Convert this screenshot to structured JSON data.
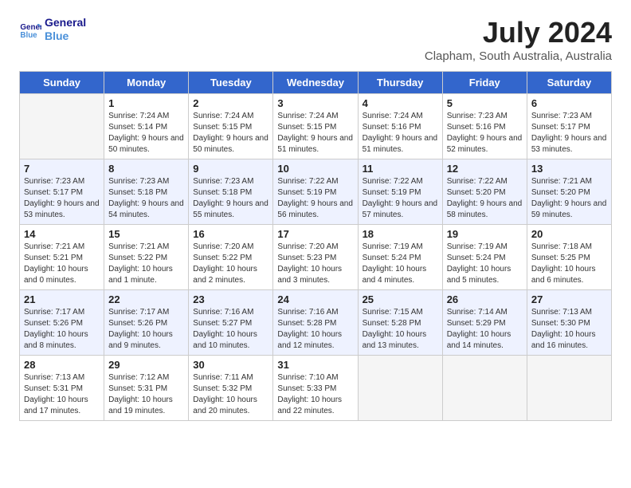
{
  "header": {
    "logo_line1": "General",
    "logo_line2": "Blue",
    "title": "July 2024",
    "subtitle": "Clapham, South Australia, Australia"
  },
  "weekdays": [
    "Sunday",
    "Monday",
    "Tuesday",
    "Wednesday",
    "Thursday",
    "Friday",
    "Saturday"
  ],
  "weeks": [
    [
      {
        "day": "",
        "sunrise": "",
        "sunset": "",
        "daylight": ""
      },
      {
        "day": "1",
        "sunrise": "Sunrise: 7:24 AM",
        "sunset": "Sunset: 5:14 PM",
        "daylight": "Daylight: 9 hours and 50 minutes."
      },
      {
        "day": "2",
        "sunrise": "Sunrise: 7:24 AM",
        "sunset": "Sunset: 5:15 PM",
        "daylight": "Daylight: 9 hours and 50 minutes."
      },
      {
        "day": "3",
        "sunrise": "Sunrise: 7:24 AM",
        "sunset": "Sunset: 5:15 PM",
        "daylight": "Daylight: 9 hours and 51 minutes."
      },
      {
        "day": "4",
        "sunrise": "Sunrise: 7:24 AM",
        "sunset": "Sunset: 5:16 PM",
        "daylight": "Daylight: 9 hours and 51 minutes."
      },
      {
        "day": "5",
        "sunrise": "Sunrise: 7:23 AM",
        "sunset": "Sunset: 5:16 PM",
        "daylight": "Daylight: 9 hours and 52 minutes."
      },
      {
        "day": "6",
        "sunrise": "Sunrise: 7:23 AM",
        "sunset": "Sunset: 5:17 PM",
        "daylight": "Daylight: 9 hours and 53 minutes."
      }
    ],
    [
      {
        "day": "7",
        "sunrise": "Sunrise: 7:23 AM",
        "sunset": "Sunset: 5:17 PM",
        "daylight": "Daylight: 9 hours and 53 minutes."
      },
      {
        "day": "8",
        "sunrise": "Sunrise: 7:23 AM",
        "sunset": "Sunset: 5:18 PM",
        "daylight": "Daylight: 9 hours and 54 minutes."
      },
      {
        "day": "9",
        "sunrise": "Sunrise: 7:23 AM",
        "sunset": "Sunset: 5:18 PM",
        "daylight": "Daylight: 9 hours and 55 minutes."
      },
      {
        "day": "10",
        "sunrise": "Sunrise: 7:22 AM",
        "sunset": "Sunset: 5:19 PM",
        "daylight": "Daylight: 9 hours and 56 minutes."
      },
      {
        "day": "11",
        "sunrise": "Sunrise: 7:22 AM",
        "sunset": "Sunset: 5:19 PM",
        "daylight": "Daylight: 9 hours and 57 minutes."
      },
      {
        "day": "12",
        "sunrise": "Sunrise: 7:22 AM",
        "sunset": "Sunset: 5:20 PM",
        "daylight": "Daylight: 9 hours and 58 minutes."
      },
      {
        "day": "13",
        "sunrise": "Sunrise: 7:21 AM",
        "sunset": "Sunset: 5:20 PM",
        "daylight": "Daylight: 9 hours and 59 minutes."
      }
    ],
    [
      {
        "day": "14",
        "sunrise": "Sunrise: 7:21 AM",
        "sunset": "Sunset: 5:21 PM",
        "daylight": "Daylight: 10 hours and 0 minutes."
      },
      {
        "day": "15",
        "sunrise": "Sunrise: 7:21 AM",
        "sunset": "Sunset: 5:22 PM",
        "daylight": "Daylight: 10 hours and 1 minute."
      },
      {
        "day": "16",
        "sunrise": "Sunrise: 7:20 AM",
        "sunset": "Sunset: 5:22 PM",
        "daylight": "Daylight: 10 hours and 2 minutes."
      },
      {
        "day": "17",
        "sunrise": "Sunrise: 7:20 AM",
        "sunset": "Sunset: 5:23 PM",
        "daylight": "Daylight: 10 hours and 3 minutes."
      },
      {
        "day": "18",
        "sunrise": "Sunrise: 7:19 AM",
        "sunset": "Sunset: 5:24 PM",
        "daylight": "Daylight: 10 hours and 4 minutes."
      },
      {
        "day": "19",
        "sunrise": "Sunrise: 7:19 AM",
        "sunset": "Sunset: 5:24 PM",
        "daylight": "Daylight: 10 hours and 5 minutes."
      },
      {
        "day": "20",
        "sunrise": "Sunrise: 7:18 AM",
        "sunset": "Sunset: 5:25 PM",
        "daylight": "Daylight: 10 hours and 6 minutes."
      }
    ],
    [
      {
        "day": "21",
        "sunrise": "Sunrise: 7:17 AM",
        "sunset": "Sunset: 5:26 PM",
        "daylight": "Daylight: 10 hours and 8 minutes."
      },
      {
        "day": "22",
        "sunrise": "Sunrise: 7:17 AM",
        "sunset": "Sunset: 5:26 PM",
        "daylight": "Daylight: 10 hours and 9 minutes."
      },
      {
        "day": "23",
        "sunrise": "Sunrise: 7:16 AM",
        "sunset": "Sunset: 5:27 PM",
        "daylight": "Daylight: 10 hours and 10 minutes."
      },
      {
        "day": "24",
        "sunrise": "Sunrise: 7:16 AM",
        "sunset": "Sunset: 5:28 PM",
        "daylight": "Daylight: 10 hours and 12 minutes."
      },
      {
        "day": "25",
        "sunrise": "Sunrise: 7:15 AM",
        "sunset": "Sunset: 5:28 PM",
        "daylight": "Daylight: 10 hours and 13 minutes."
      },
      {
        "day": "26",
        "sunrise": "Sunrise: 7:14 AM",
        "sunset": "Sunset: 5:29 PM",
        "daylight": "Daylight: 10 hours and 14 minutes."
      },
      {
        "day": "27",
        "sunrise": "Sunrise: 7:13 AM",
        "sunset": "Sunset: 5:30 PM",
        "daylight": "Daylight: 10 hours and 16 minutes."
      }
    ],
    [
      {
        "day": "28",
        "sunrise": "Sunrise: 7:13 AM",
        "sunset": "Sunset: 5:31 PM",
        "daylight": "Daylight: 10 hours and 17 minutes."
      },
      {
        "day": "29",
        "sunrise": "Sunrise: 7:12 AM",
        "sunset": "Sunset: 5:31 PM",
        "daylight": "Daylight: 10 hours and 19 minutes."
      },
      {
        "day": "30",
        "sunrise": "Sunrise: 7:11 AM",
        "sunset": "Sunset: 5:32 PM",
        "daylight": "Daylight: 10 hours and 20 minutes."
      },
      {
        "day": "31",
        "sunrise": "Sunrise: 7:10 AM",
        "sunset": "Sunset: 5:33 PM",
        "daylight": "Daylight: 10 hours and 22 minutes."
      },
      {
        "day": "",
        "sunrise": "",
        "sunset": "",
        "daylight": ""
      },
      {
        "day": "",
        "sunrise": "",
        "sunset": "",
        "daylight": ""
      },
      {
        "day": "",
        "sunrise": "",
        "sunset": "",
        "daylight": ""
      }
    ]
  ]
}
